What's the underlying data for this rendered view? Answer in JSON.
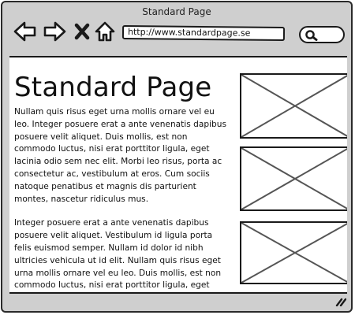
{
  "window": {
    "title": "Standard Page"
  },
  "toolbar": {
    "back_icon": "arrow-left-icon",
    "forward_icon": "arrow-right-icon",
    "stop_icon": "close-x-icon",
    "home_icon": "home-icon",
    "search_icon": "search-icon"
  },
  "address_bar": {
    "url": "http://www.standardpage.se"
  },
  "page": {
    "heading": "Standard Page",
    "paragraphs": [
      "Nullam quis risus eget urna mollis ornare vel eu leo. Integer posuere erat a ante venenatis dapibus posuere velit aliquet. Duis mollis, est non commodo luctus, nisi erat porttitor ligula, eget lacinia odio sem nec elit. Morbi leo risus, porta ac consectetur ac, vestibulum at eros. Cum sociis natoque penatibus et magnis dis parturient montes, nascetur ridiculus mus.",
      "Integer posuere erat a ante venenatis dapibus posuere velit aliquet. Vestibulum id ligula porta felis euismod semper. Nullam id dolor id nibh ultricies vehicula ut id elit. Nullam quis risus eget urna mollis ornare vel eu leo. Duis mollis, est non commodo luctus, nisi erat porttitor ligula, eget lacinia odio sem nec elit."
    ],
    "images": [
      {
        "name": "image-placeholder-1"
      },
      {
        "name": "image-placeholder-2"
      },
      {
        "name": "image-placeholder-3"
      }
    ]
  },
  "statusbar": {
    "grip_icon": "resize-grip-icon"
  }
}
